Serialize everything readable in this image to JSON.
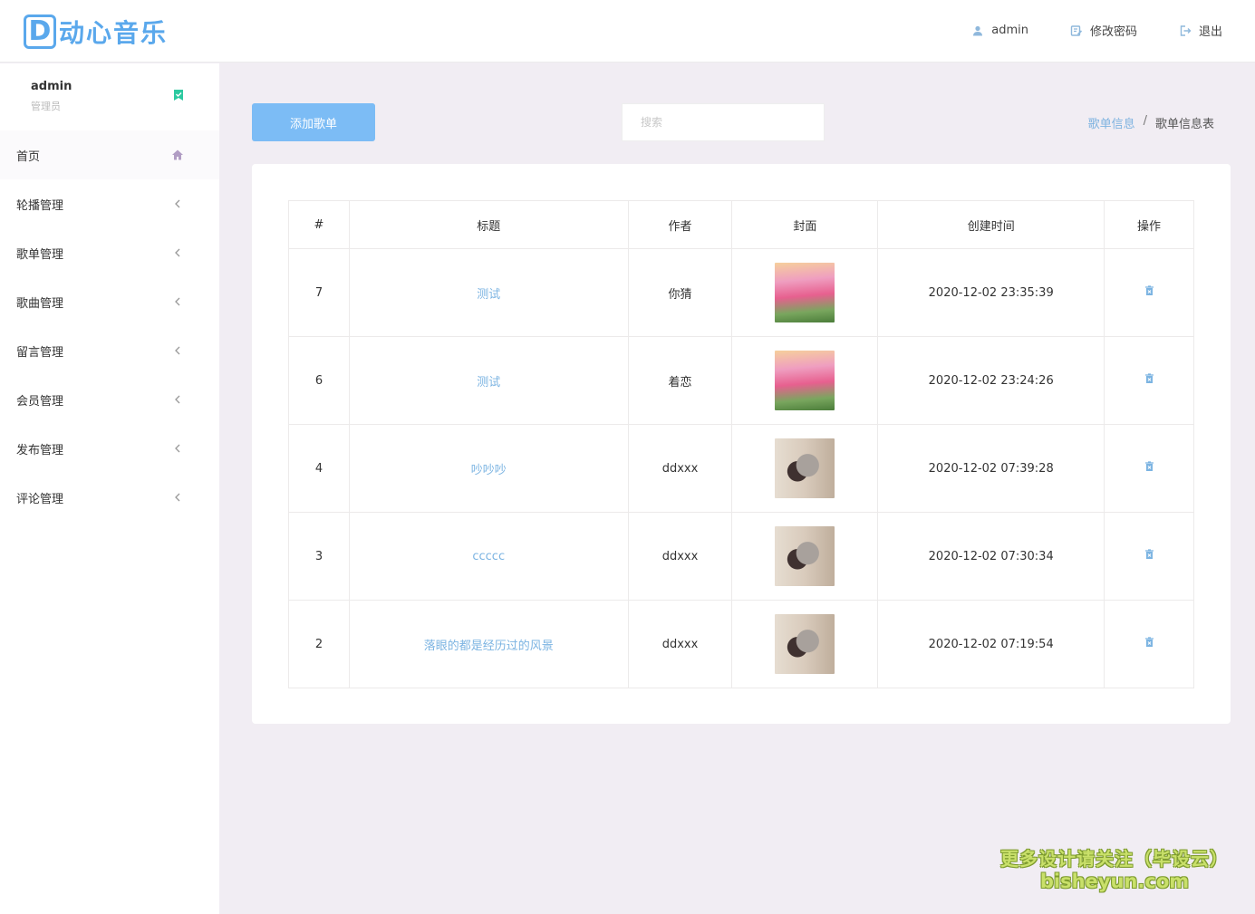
{
  "app": {
    "logo_letter": "D",
    "logo_text": "动心音乐"
  },
  "top_nav": {
    "user": "admin",
    "change_password": "修改密码",
    "logout": "退出"
  },
  "sidebar": {
    "user_name": "admin",
    "user_role": "管理员",
    "items": [
      {
        "label": "首页"
      },
      {
        "label": "轮播管理"
      },
      {
        "label": "歌单管理"
      },
      {
        "label": "歌曲管理"
      },
      {
        "label": "留言管理"
      },
      {
        "label": "会员管理"
      },
      {
        "label": "发布管理"
      },
      {
        "label": "评论管理"
      }
    ]
  },
  "toolbar": {
    "add_label": "添加歌单",
    "search_placeholder": "搜索"
  },
  "breadcrumb": {
    "parent": "歌单信息",
    "separator": "/",
    "current": "歌单信息表"
  },
  "table": {
    "headers": [
      "#",
      "标题",
      "作者",
      "封面",
      "创建时间",
      "操作"
    ],
    "rows": [
      {
        "id": "7",
        "title": "测试",
        "author": "你猜",
        "cover": "flowers",
        "created": "2020-12-02 23:35:39"
      },
      {
        "id": "6",
        "title": "测试",
        "author": "着恋",
        "cover": "flowers",
        "created": "2020-12-02 23:24:26"
      },
      {
        "id": "4",
        "title": "吵吵吵",
        "author": "ddxxx",
        "cover": "couple",
        "created": "2020-12-02 07:39:28"
      },
      {
        "id": "3",
        "title": "ccccc",
        "author": "ddxxx",
        "cover": "couple",
        "created": "2020-12-02 07:30:34"
      },
      {
        "id": "2",
        "title": "落眼的都是经历过的风景",
        "author": "ddxxx",
        "cover": "couple",
        "created": "2020-12-02 07:19:54"
      }
    ]
  },
  "watermark": {
    "line1": "更多设计请关注（毕设云）",
    "line2": "bisheyun.com"
  },
  "colors": {
    "accent": "#7cbcf5",
    "link": "#7cb4e2",
    "background": "#f1edf3",
    "logo": "#5aa8ec"
  },
  "icons": {
    "user": "user-icon",
    "password": "edit-icon",
    "logout": "logout-icon",
    "check": "check-badge-icon",
    "home": "home-icon",
    "chevron": "chevron-left-icon",
    "delete": "trash-icon"
  }
}
